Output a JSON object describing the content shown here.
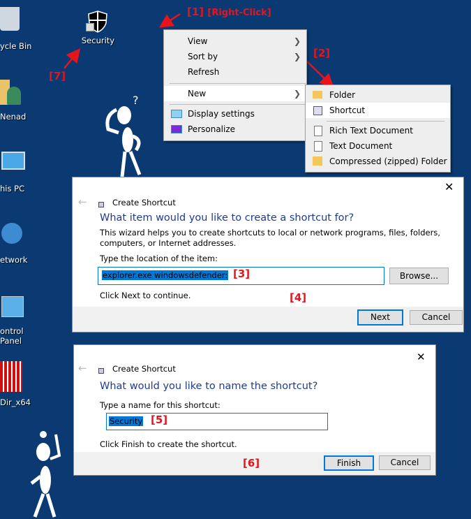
{
  "desktop": {
    "icons": [
      {
        "label": "ycle Bin",
        "icon": "recycle-bin-icon"
      },
      {
        "label": "Nenad",
        "icon": "user-folder-icon"
      },
      {
        "label": "his PC",
        "icon": "computer-icon"
      },
      {
        "label": "etwork",
        "icon": "network-icon"
      },
      {
        "label": "ontrol Panel",
        "icon": "control-panel-icon"
      },
      {
        "label": "Dir_x64",
        "icon": "app-icon"
      }
    ],
    "security_shortcut": {
      "label": "Security",
      "icon": "shield-icon"
    }
  },
  "annotations": {
    "step1": "[1]",
    "step1_note": "[Right-Click]",
    "step2": "[2]",
    "step3": "[3]",
    "step4": "[4]",
    "step5": "[5]",
    "step6": "[6]",
    "step7": "[7]"
  },
  "context_menu": {
    "items": [
      "View",
      "Sort by",
      "Refresh",
      "New",
      "Display settings",
      "Personalize"
    ]
  },
  "new_submenu": {
    "items": [
      "Folder",
      "Shortcut",
      "Rich Text Document",
      "Text Document",
      "Compressed (zipped) Folder"
    ]
  },
  "dialog1": {
    "title": "Create Shortcut",
    "heading": "What item would you like to create a shortcut for?",
    "description": "This wizard helps you to create shortcuts to local or network programs, files, folders, computers, or Internet addresses.",
    "field_label": "Type the location of the item:",
    "field_value": "explorer.exe windowsdefender:",
    "browse": "Browse...",
    "hint": "Click Next to continue.",
    "next": "Next",
    "cancel": "Cancel"
  },
  "dialog2": {
    "title": "Create Shortcut",
    "heading": "What would you like to name the shortcut?",
    "field_label": "Type a name for this shortcut:",
    "field_value": "Security",
    "hint": "Click Finish to create the shortcut.",
    "finish": "Finish",
    "cancel": "Cancel"
  },
  "colors": {
    "desktop": "#0b3a73",
    "annotation": "#e8141b",
    "accent": "#0078d7"
  }
}
